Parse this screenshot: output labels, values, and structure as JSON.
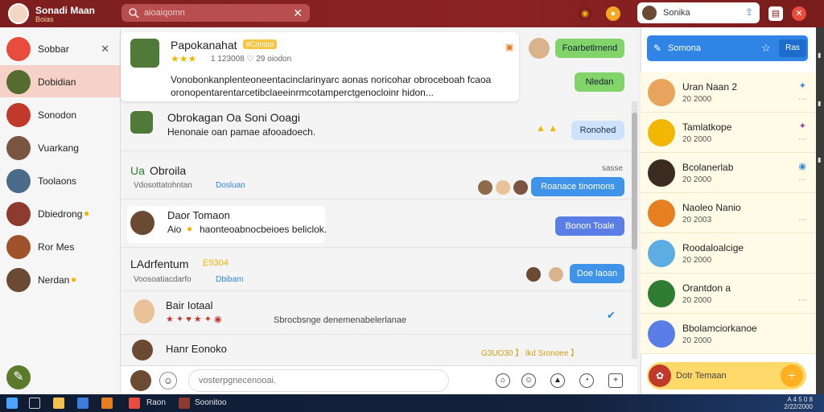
{
  "topbar": {
    "title": "Sonadi Maan",
    "subtitle": "Boias",
    "search_placeholder": "aioaiqomn",
    "user_name": "Sonika"
  },
  "sidebar": {
    "items": [
      {
        "label": "Sobbar",
        "color": "#e74c3c"
      },
      {
        "label": "Dobidian",
        "color": "#556b2f"
      },
      {
        "label": "Sonodon",
        "color": "#c0392b"
      },
      {
        "label": "Vuarkang",
        "color": "#7a5542"
      },
      {
        "label": "Toolaons",
        "color": "#4a6b8a"
      },
      {
        "label": "Dbiedrong",
        "color": "#8e3b2f"
      },
      {
        "label": "Ror Mes",
        "color": "#a0522d"
      },
      {
        "label": "Nerdan",
        "color": "#6b4a34"
      }
    ]
  },
  "chat": {
    "pinned": {
      "name": "Papokanahat",
      "badge": "#Cnnoto",
      "meta": "1 123008 ♡ 29 oiodon",
      "text_line1": "Vonobonkanplenteoneentacinclarinyarc aonas noricohar obroceboah fcaoa",
      "text_line2": "oronopentarentarcetibclaeeinrmcotamperctgenocloinr hidon...",
      "bubble_top": "Foarbetlrnend",
      "bubble_bottom": "Nledan"
    },
    "rows": [
      {
        "name": "Obrokagan Oa Soni Ooagi",
        "text": "Henonaie oan pamae afooadoech.",
        "bubble": "Ronohed"
      },
      {
        "name": "Obroila",
        "prefix": "Ua",
        "meta_left": "Vdosottatohntan",
        "meta_link": "Dosluan",
        "meta_right": "sasse",
        "bubble": "Roanace tinomons"
      },
      {
        "name": "Daor Tomaon",
        "text": "Aio",
        "text2": "haonteoabnocbeioes beliclok.",
        "bubble": "Bonon Toale"
      },
      {
        "name": "LAdrfentum",
        "tag": "E9304",
        "meta_left": "Voosoatiacdarfo",
        "meta_link": "Dbibam",
        "bubble": "Doe laoan"
      },
      {
        "name": "Bair Iotaal",
        "text": "Sbrocbsnge denemenabelerlanae"
      },
      {
        "name": "Hanr Eonoko",
        "tag": "G3UO30 】 lkd Sronoee 】"
      }
    ]
  },
  "composer": {
    "placeholder": "vosterpgnecenooai."
  },
  "right_panel": {
    "header": "Somona",
    "header_button": "Ras",
    "contacts": [
      {
        "name": "Uran Naan 2",
        "time": "20 2000"
      },
      {
        "name": "Tamlatkope",
        "time": "20 2000"
      },
      {
        "name": "Bcolanerlab",
        "time": "20 2000"
      },
      {
        "name": "Naoleo Nanio",
        "time": "20 2003"
      },
      {
        "name": "Roodaloalcige",
        "time": "20 2000"
      },
      {
        "name": "Orantdon a",
        "time": "20 2000"
      },
      {
        "name": "Bbolamciorkanoe",
        "time": "20 2000"
      }
    ],
    "footer": "Dotr Temaan"
  },
  "taskbar": {
    "app1": "Raon",
    "app2": "Soonitoo",
    "clock_line1": "A 4 5 0 8",
    "clock_line2": "2/22/2000"
  },
  "colors": {
    "topbar": "#7d1e1e",
    "accent_blue": "#2f84e6",
    "accent_green": "#82d36a",
    "highlight": "#f6d1c7"
  }
}
